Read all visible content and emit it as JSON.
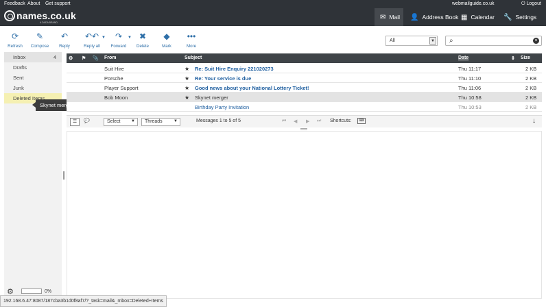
{
  "topbar": {
    "links": [
      "Feedback",
      "About",
      "Get support"
    ],
    "domain": "webmailguide.co.uk",
    "logout": "Logout",
    "logo_text": "names.co.uk",
    "logo_sub": "A DADA BRAND",
    "nav": [
      {
        "label": "Mail",
        "icon": "mail-icon",
        "active": true
      },
      {
        "label": "Address Book",
        "icon": "person-icon"
      },
      {
        "label": "Calendar",
        "icon": "calendar-icon"
      },
      {
        "label": "Settings",
        "icon": "wrench-icon"
      }
    ]
  },
  "toolbar": {
    "refresh": "Refresh",
    "compose": "Compose",
    "reply": "Reply",
    "reply_all": "Reply all",
    "forward": "Forward",
    "delete": "Delete",
    "mark": "Mark",
    "more": "More"
  },
  "filter": {
    "value": "All"
  },
  "search": {
    "placeholder": ""
  },
  "folders": [
    {
      "name": "Inbox",
      "count": "4"
    },
    {
      "name": "Drafts",
      "count": ""
    },
    {
      "name": "Sent",
      "count": ""
    },
    {
      "name": "Junk",
      "count": ""
    },
    {
      "name": "Deleted Items",
      "count": ""
    }
  ],
  "drag_tooltip": "Skynet merger",
  "quota": {
    "percent": "0%",
    "fill": 0
  },
  "list": {
    "columns": {
      "from": "From",
      "subject": "Subject",
      "date": "Date",
      "size": "Size"
    },
    "rows": [
      {
        "from": "Suit Hire",
        "subject": "Re: Suit Hire Enquiry 221020273",
        "date": "Thu 11:17",
        "size": "2 KB",
        "starred": true
      },
      {
        "from": "Porsche",
        "subject": "Re: Your service is due",
        "date": "Thu 11:10",
        "size": "2 KB",
        "starred": true
      },
      {
        "from": "Player Support",
        "subject": "Good news about your National Lottery Ticket!",
        "date": "Thu 11:06",
        "size": "2 KB",
        "starred": true
      },
      {
        "from": "Bob Moon",
        "subject": "Skynet merger",
        "date": "Thu 10:58",
        "size": "2 KB",
        "starred": true
      },
      {
        "from": "",
        "subject": "Birthday Party Invitation",
        "date": "Thu 10:53",
        "size": "2 KB",
        "starred": false
      }
    ]
  },
  "footer": {
    "select": "Select",
    "threads": "Threads",
    "count_text": "Messages 1 to 5 of 5",
    "shortcuts": "Shortcuts:"
  },
  "status_url": "192.168.6.47:8087/187cba3b1d0f8af7/?_task=mail&_mbox=Deleted+Items"
}
